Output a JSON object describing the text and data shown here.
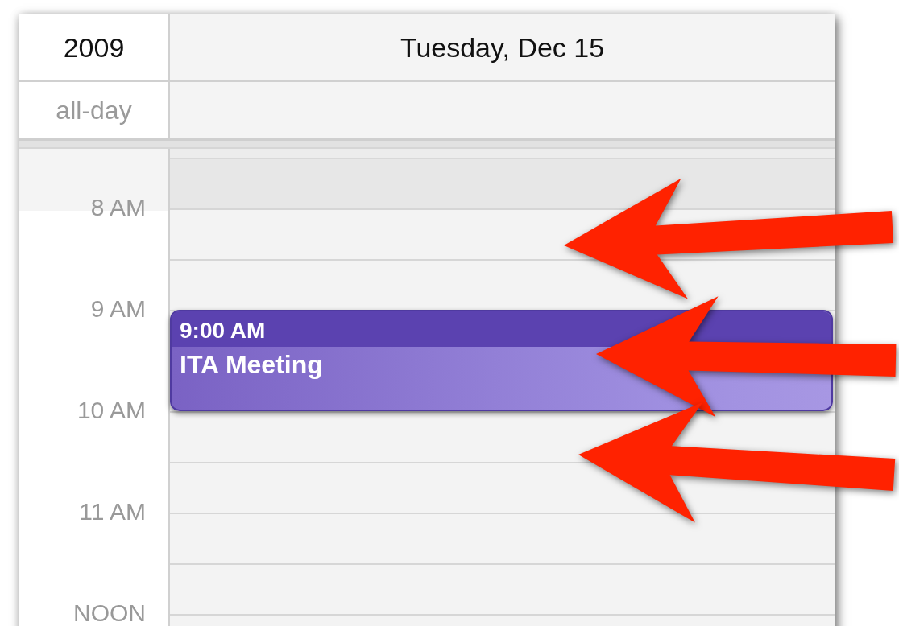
{
  "header": {
    "year": "2009",
    "day_title": "Tuesday, Dec 15"
  },
  "all_day": {
    "label": "all-day"
  },
  "hours": [
    "8 AM",
    "9 AM",
    "10 AM",
    "11 AM",
    "NOON"
  ],
  "events": [
    {
      "time": "9:00 AM",
      "title": "ITA Meeting"
    }
  ]
}
